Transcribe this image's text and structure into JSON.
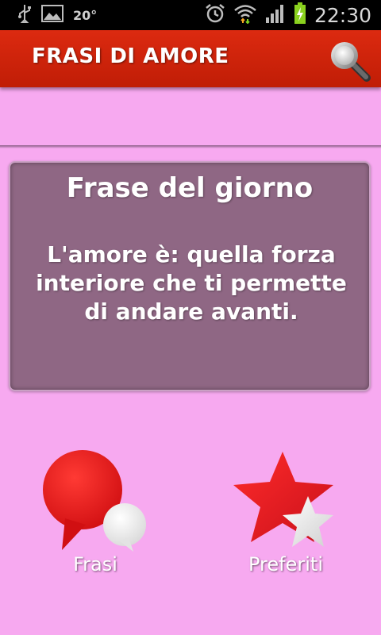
{
  "statusbar": {
    "temperature": "20°",
    "time": "22:30"
  },
  "appbar": {
    "title": "FRASI DI AMORE",
    "search_icon": "search-icon"
  },
  "quote_card": {
    "title": "Frase del giorno",
    "text": "L'amore è: quella forza interiore che ti permette di andare avanti."
  },
  "nav": {
    "frasi_label": "Frasi",
    "preferiti_label": "Preferiti"
  },
  "colors": {
    "background": "#f7a9f0",
    "appbar": "#d2240c",
    "card": "#8f6784",
    "accent_red": "#e8141a"
  }
}
